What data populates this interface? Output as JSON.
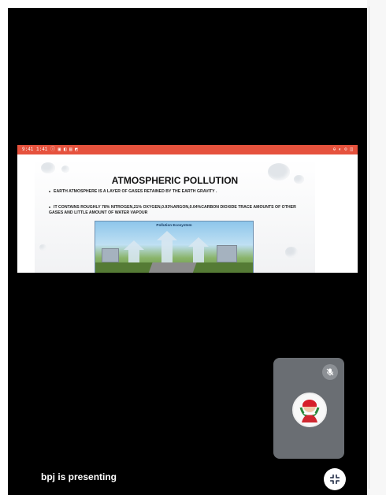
{
  "meeting": {
    "presenting_label": "bpj is presenting"
  },
  "shared_screen": {
    "status_left": "9:41 1:41 ⓘ ▣ ◧ ▤ ◩",
    "status_right": "⊖ ◐ ⊙ ◫",
    "slide_title": "ATMOSPHERIC POLLUTION",
    "bullets": [
      "EARTH ATMOSPHERE IS A LAYER OF GASES RETAINED BY THE EARTH GRAVITY .",
      "IT CONTAINS ROUGHLY 78% NITROGEN,21% OXYGEN,0.93%ARGON,0.04%CARBON DIOXIDE TRACE AMOUNTS OF OTHER GASES AND LITTLE AMOUNT OF WATER VAPOUR"
    ],
    "diagram_title": "Pollution Ecosystem"
  },
  "participant_tile": {
    "icons": {
      "mute": "mic-off-icon",
      "avatar": "participant-avatar"
    }
  },
  "controls": {
    "collapse_icon": "collapse-icon"
  },
  "colors": {
    "background": "#000000",
    "status_bar": "#e6523d",
    "tile": "#6a6e73",
    "button": "#ffffff"
  }
}
